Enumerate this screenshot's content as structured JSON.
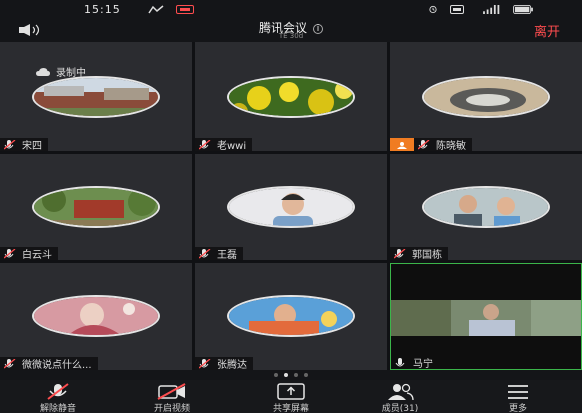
{
  "status_bar": {
    "time": "15:15"
  },
  "header": {
    "title": "腾讯会议",
    "subtitle": "TE 30d",
    "leave_label": "离开"
  },
  "participants": [
    {
      "name": "宋四",
      "host": false,
      "active": false
    },
    {
      "name": "老wwi",
      "host": false,
      "active": false
    },
    {
      "name": "陈晓敏",
      "host": true,
      "active": false
    },
    {
      "name": "白云斗",
      "host": false,
      "active": false
    },
    {
      "name": "王磊",
      "host": false,
      "active": false
    },
    {
      "name": "郭国栋",
      "host": false,
      "active": false
    },
    {
      "name": "微微说点什么...",
      "host": false,
      "active": false
    },
    {
      "name": "张腾达",
      "host": false,
      "active": false
    },
    {
      "name": "马宁",
      "host": false,
      "active": true
    }
  ],
  "recording_label": "录制中",
  "pagination": {
    "pages": 4,
    "current": 2
  },
  "toolbar": [
    {
      "label": "解除静音",
      "icon": "mic-muted-icon"
    },
    {
      "label": "开启视频",
      "icon": "camera-off-icon"
    },
    {
      "label": "共享屏幕",
      "icon": "share-screen-icon"
    },
    {
      "label": "成员(31)",
      "icon": "members-icon"
    },
    {
      "label": "更多",
      "icon": "more-icon"
    }
  ],
  "colors": {
    "accent_red": "#ff4d4f",
    "host_badge": "#f07c22",
    "active_border": "#3bb54a"
  }
}
